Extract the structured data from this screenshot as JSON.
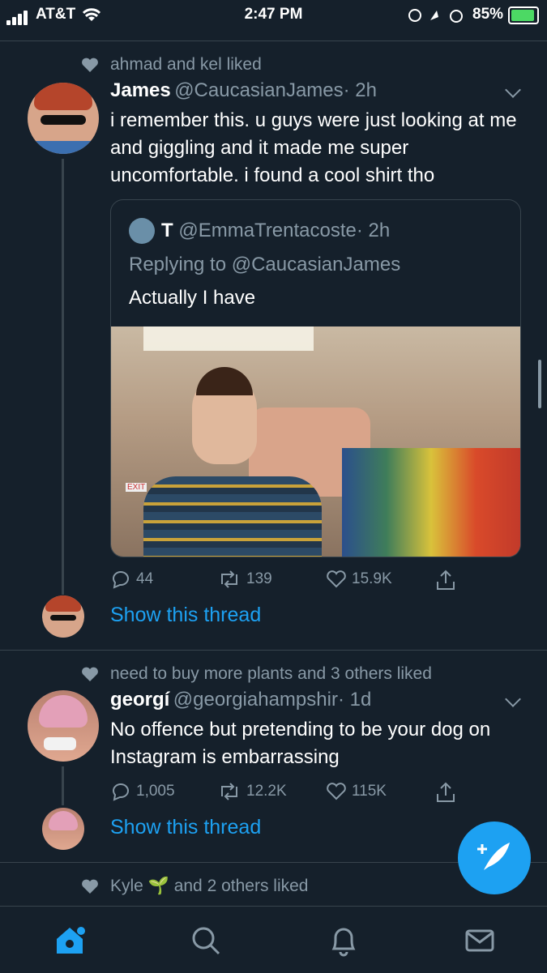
{
  "status": {
    "carrier": "AT&T",
    "time": "2:47 PM",
    "battery": "85%"
  },
  "tweet1": {
    "liked_by": "ahmad and kel liked",
    "name": "James",
    "handle": "@CaucasianJames",
    "age": "· 2h",
    "text": "i remember this. u guys were just looking at me and giggling and it made me super uncomfortable. i found a cool shirt tho",
    "quote": {
      "name": "T",
      "handle": "@EmmaTrentacoste",
      "age": "· 2h",
      "replying": "Replying to @CaucasianJames",
      "text": "Actually I have",
      "exit_sign": "EXIT"
    },
    "replies": "44",
    "retweets": "139",
    "likes": "15.9K",
    "show_thread": "Show this thread"
  },
  "tweet2": {
    "liked_by": "need to buy more plants and 3 others liked",
    "name": "georgí",
    "handle": "@georgiahampshir",
    "age": "· 1d",
    "text": "No offence but pretending to be your dog on Instagram is embarrassing",
    "replies": "1,005",
    "retweets": "12.2K",
    "likes": "115K",
    "show_thread": "Show this thread"
  },
  "tweet3": {
    "liked_by_name": "Kyle",
    "liked_by_rest": "and 2 others liked"
  },
  "colors": {
    "background": "#15202b",
    "accent": "#1da1f2",
    "muted": "#8899a6",
    "border": "#38444d"
  },
  "icons": [
    "home-icon",
    "search-icon",
    "notifications-icon",
    "messages-icon",
    "compose-tweet-icon"
  ]
}
